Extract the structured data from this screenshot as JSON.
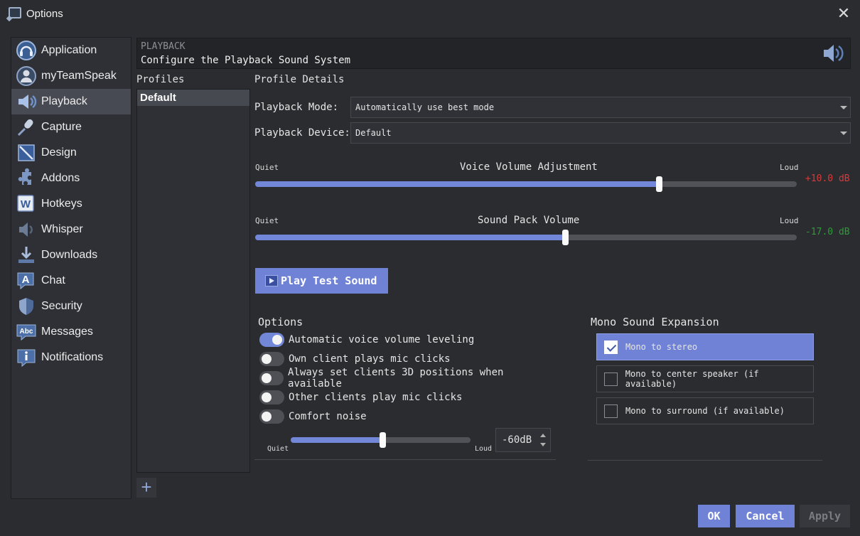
{
  "window": {
    "title": "Options",
    "close": "✕"
  },
  "sidebar": {
    "items": [
      {
        "label": "Application",
        "icon": "headset-icon",
        "active": false
      },
      {
        "label": "myTeamSpeak",
        "icon": "user-avatar-icon",
        "active": false
      },
      {
        "label": "Playback",
        "icon": "speaker-icon",
        "active": true
      },
      {
        "label": "Capture",
        "icon": "microphone-icon",
        "active": false
      },
      {
        "label": "Design",
        "icon": "design-icon",
        "active": false
      },
      {
        "label": "Addons",
        "icon": "puzzle-icon",
        "active": false
      },
      {
        "label": "Hotkeys",
        "icon": "keyboard-w-icon",
        "active": false
      },
      {
        "label": "Whisper",
        "icon": "whisper-speaker-icon",
        "active": false
      },
      {
        "label": "Downloads",
        "icon": "download-icon",
        "active": false
      },
      {
        "label": "Chat",
        "icon": "chat-a-icon",
        "active": false
      },
      {
        "label": "Security",
        "icon": "shield-icon",
        "active": false
      },
      {
        "label": "Messages",
        "icon": "abc-icon",
        "active": false
      },
      {
        "label": "Notifications",
        "icon": "info-icon",
        "active": false
      }
    ]
  },
  "header": {
    "section": "PLAYBACK",
    "subtitle": "Configure the Playback Sound System"
  },
  "profiles": {
    "label": "Profiles",
    "items": [
      "Default"
    ],
    "add": "+"
  },
  "details": {
    "label": "Profile Details",
    "playback_mode": {
      "label": "Playback Mode:",
      "value": "Automatically use best mode"
    },
    "playback_device": {
      "label": "Playback Device:",
      "value": "Default"
    },
    "voice_volume": {
      "title": "Voice Volume Adjustment",
      "min_label": "Quiet",
      "max_label": "Loud",
      "value_text": "+10.0 dB",
      "level": 0.745,
      "color": "#d63b3b"
    },
    "sound_pack": {
      "title": "Sound Pack Volume",
      "min_label": "Quiet",
      "max_label": "Loud",
      "value_text": "-17.0 dB",
      "level": 0.572,
      "color": "#2f9a3a"
    },
    "play_test": "Play Test Sound"
  },
  "options": {
    "title": "Options",
    "toggles": [
      {
        "label": "Automatic voice volume leveling",
        "on": true
      },
      {
        "label": "Own client plays mic clicks",
        "on": false
      },
      {
        "label": "Always set clients 3D positions when available",
        "on": false
      },
      {
        "label": "Other clients play mic clicks",
        "on": false
      },
      {
        "label": "Comfort noise",
        "on": false
      }
    ],
    "noise_slider": {
      "min_label": "Quiet",
      "max_label": "Loud",
      "level": 0.51
    },
    "noise_value": "-60dB"
  },
  "mono": {
    "title": "Mono Sound Expansion",
    "options": [
      {
        "label": "Mono to stereo",
        "checked": true
      },
      {
        "label": "Mono to center speaker (if available)",
        "checked": false
      },
      {
        "label": "Mono to surround (if available)",
        "checked": false
      }
    ]
  },
  "buttons": {
    "ok": "OK",
    "cancel": "Cancel",
    "apply": "Apply"
  },
  "colors": {
    "accent": "#6f82d6",
    "background": "#2b2c30"
  }
}
